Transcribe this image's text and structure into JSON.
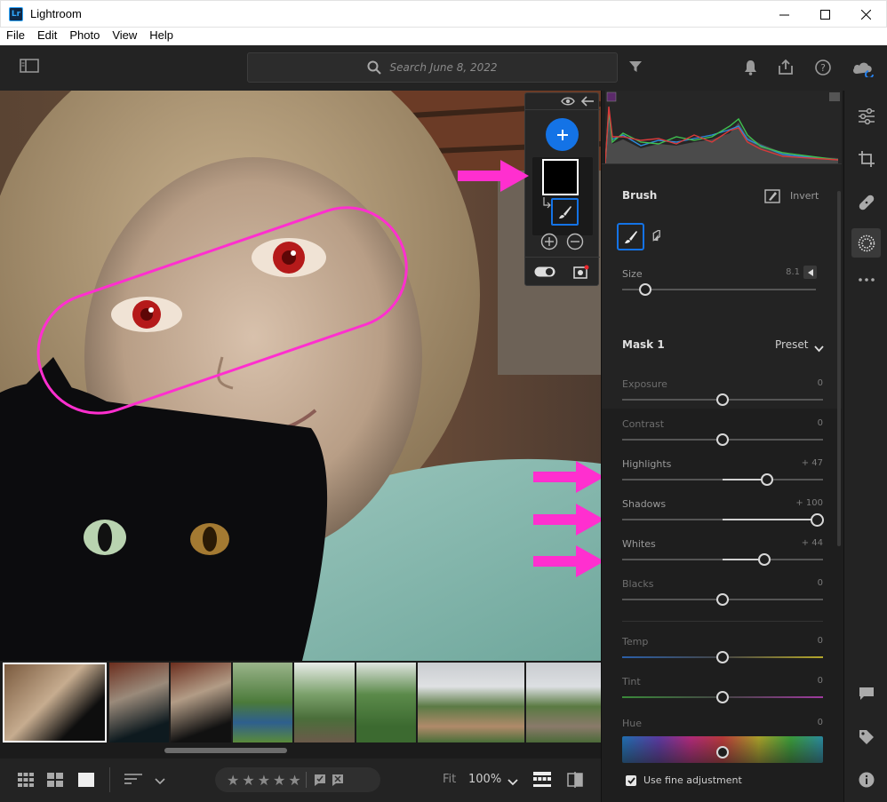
{
  "window": {
    "app_title": "Lightroom",
    "logo_text": "Lr"
  },
  "menu": [
    "File",
    "Edit",
    "Photo",
    "View",
    "Help"
  ],
  "toolbar": {
    "search_placeholder": "Search June 8, 2022"
  },
  "brush": {
    "title": "Brush",
    "invert_label": "Invert",
    "size_label": "Size",
    "size_value": "8.1",
    "size_level": 0.12
  },
  "mask": {
    "title": "Mask 1",
    "preset_label": "Preset",
    "sliders": [
      {
        "label": "Exposure",
        "value": "0",
        "level": 0
      },
      {
        "label": "Contrast",
        "value": "0",
        "level": 0
      },
      {
        "label": "Highlights",
        "value": "+ 47",
        "level": 47
      },
      {
        "label": "Shadows",
        "value": "+ 100",
        "level": 100
      },
      {
        "label": "Whites",
        "value": "+ 44",
        "level": 44
      },
      {
        "label": "Blacks",
        "value": "0",
        "level": 0
      }
    ],
    "color_sliders": [
      {
        "label": "Temp",
        "value": "0"
      },
      {
        "label": "Tint",
        "value": "0"
      },
      {
        "label": "Hue",
        "value": "0"
      }
    ],
    "fine_adjust_label": "Use fine adjustment",
    "fine_adjust_checked": true
  },
  "bottombar": {
    "fit_label": "Fit",
    "zoom_label": "100%"
  },
  "colors": {
    "accent": "#1473e6",
    "annotation": "#ff2fcf"
  }
}
